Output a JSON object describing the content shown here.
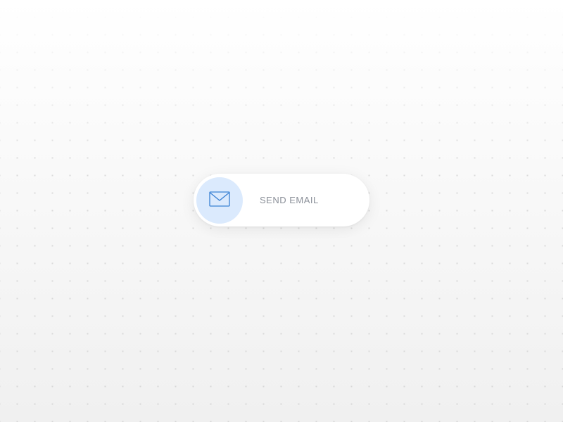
{
  "button": {
    "label": "SEND EMAIL",
    "icon_name": "envelope-icon"
  },
  "colors": {
    "icon_circle_bg": "#dbeafd",
    "icon_stroke": "#3b82d4",
    "label_color": "#8a8f98"
  }
}
